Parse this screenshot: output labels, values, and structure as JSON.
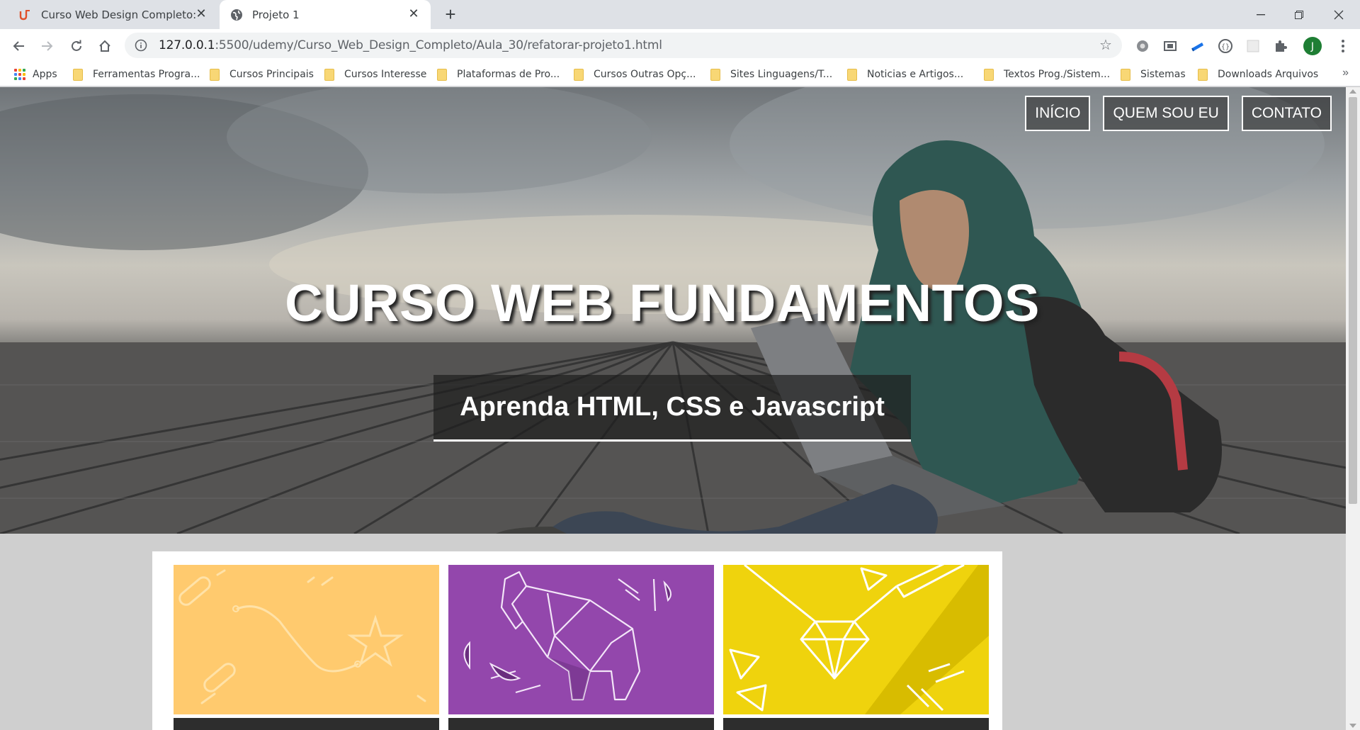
{
  "browser": {
    "tabs": [
      {
        "title": "Curso Web Design Completo: HT",
        "active": false,
        "favicon": "udemy-icon"
      },
      {
        "title": "Projeto 1",
        "active": true,
        "favicon": "globe-icon"
      }
    ],
    "url_host": "127.0.0.1",
    "url_rest": ":5500/udemy/Curso_Web_Design_Completo/Aula_30/refatorar-projeto1.html",
    "profile_initial": "J",
    "colors": {
      "tab_strip": "#dee1e6",
      "profile": "#1e7e34",
      "folder": "#f8d775"
    }
  },
  "bookmarks": {
    "apps_label": "Apps",
    "items": [
      "Ferramentas Progra...",
      "Cursos Principais",
      "Cursos Interesse",
      "Plataformas de Pro...",
      "Cursos Outras Opç...",
      "Sites Linguagens/T...",
      "Noticias e Artigos...",
      "Textos Prog./Sistem...",
      "Sistemas",
      "Downloads Arquivos"
    ],
    "more": "»"
  },
  "page": {
    "nav": [
      "INÍCIO",
      "QUEM SOU EU",
      "CONTATO"
    ],
    "hero_title": "CURSO WEB FUNDAMENTOS",
    "hero_subtitle": "Aprenda HTML, CSS e Javascript",
    "cards": [
      {
        "name": "card-orange",
        "color": "#ffca6e",
        "illustration": "star-path-illustration"
      },
      {
        "name": "card-purple",
        "color": "#9347ac",
        "illustration": "origami-elephant-illustration"
      },
      {
        "name": "card-yellow",
        "color": "#efd30d",
        "illustration": "diamond-pen-illustration"
      }
    ]
  }
}
